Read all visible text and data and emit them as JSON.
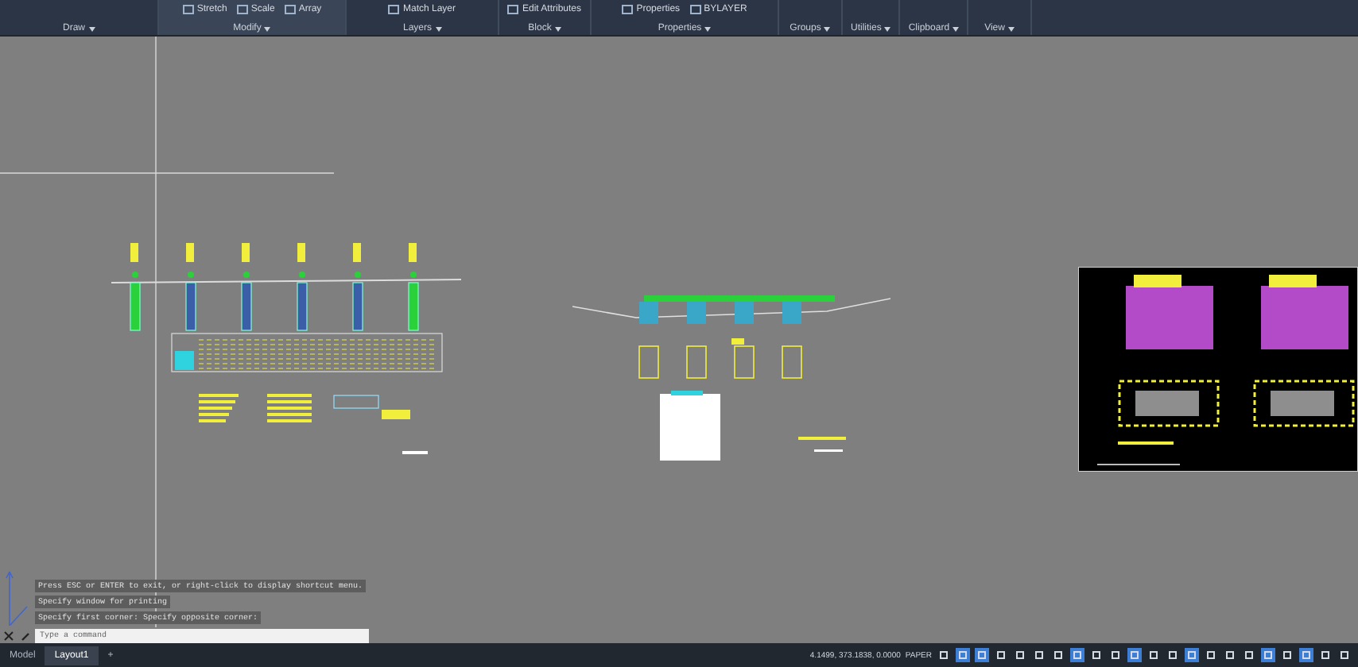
{
  "ribbon": {
    "panels": [
      {
        "label": "Draw"
      },
      {
        "label": "Modify",
        "tools": [
          "Stretch",
          "Scale",
          "Array"
        ]
      },
      {
        "label": "Layers",
        "tools": [
          "Match Layer"
        ]
      },
      {
        "label": "Block",
        "tools": [
          "Edit Attributes"
        ]
      },
      {
        "label": "Properties",
        "tools": [
          "Properties",
          "BYLAYER"
        ]
      },
      {
        "label": "Groups"
      },
      {
        "label": "Utilities"
      },
      {
        "label": "Clipboard"
      },
      {
        "label": "View"
      }
    ]
  },
  "command_history": [
    "Press ESC or ENTER to exit, or right-click to display shortcut menu.",
    "Specify window for printing",
    "Specify first corner: Specify opposite corner:"
  ],
  "command_input": {
    "placeholder": "Type a command"
  },
  "layout_tabs": [
    {
      "label": "Model",
      "selected": false
    },
    {
      "label": "Layout1",
      "selected": true
    },
    {
      "label": "+",
      "selected": false
    }
  ],
  "status_bar": {
    "coordinates": "4.1499, 373.1838, 0.0000",
    "space": "PAPER",
    "toggles": [
      {
        "on": false
      },
      {
        "on": true
      },
      {
        "on": true
      },
      {
        "on": false
      },
      {
        "on": false
      },
      {
        "on": false
      },
      {
        "on": false
      },
      {
        "on": true
      },
      {
        "on": false
      },
      {
        "on": false
      },
      {
        "on": true
      },
      {
        "on": false
      },
      {
        "on": false
      },
      {
        "on": true
      },
      {
        "on": false
      },
      {
        "on": false
      },
      {
        "on": false
      },
      {
        "on": true
      },
      {
        "on": false
      },
      {
        "on": true
      },
      {
        "on": false
      },
      {
        "on": false
      }
    ]
  }
}
